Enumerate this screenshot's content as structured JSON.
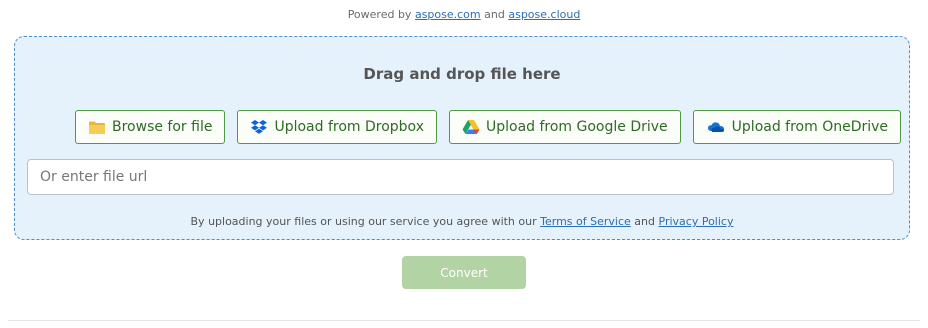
{
  "powered": {
    "prefix": "Powered by",
    "link1": "aspose.com",
    "conj": "and",
    "link2": "aspose.cloud"
  },
  "dropzone": {
    "title": "Drag and drop file here",
    "buttons": {
      "browse": {
        "label": "Browse for file",
        "icon": "folder-icon"
      },
      "dropbox": {
        "label": "Upload from Dropbox",
        "icon": "dropbox-icon"
      },
      "gdrive": {
        "label": "Upload from Google Drive",
        "icon": "google-drive-icon"
      },
      "onedrive": {
        "label": "Upload from OneDrive",
        "icon": "onedrive-icon"
      }
    },
    "url_placeholder": "Or enter file url",
    "agreement": {
      "prefix": "By uploading your files or using our service you agree with our",
      "terms": "Terms of Service",
      "conj": "and",
      "privacy": "Privacy Policy"
    }
  },
  "convert_label": "Convert",
  "colors": {
    "accent_green": "#4e9a46",
    "dropzone_bg": "#e5f1fb",
    "link": "#2a6fb5",
    "convert_disabled": "#b2d4a4"
  }
}
